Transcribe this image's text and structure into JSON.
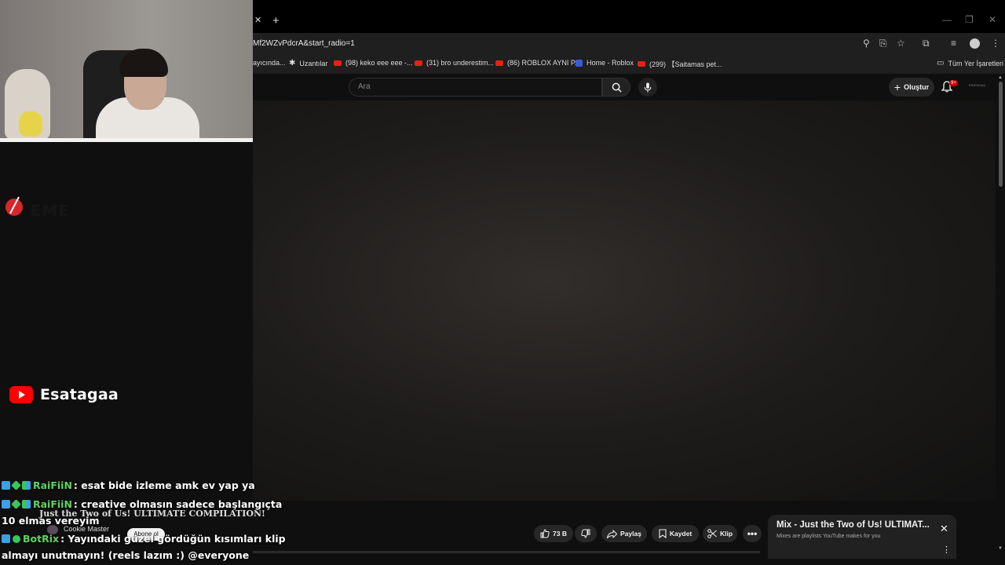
{
  "browser": {
    "url": "Mf2WZvPdcrA&start_radio=1",
    "bookmarks": [
      {
        "label": "ayıcında...",
        "icon": "none"
      },
      {
        "label": "Uzantılar",
        "icon": "puzzle"
      },
      {
        "label": "(98) keko eee eee -...",
        "icon": "youtube"
      },
      {
        "label": "(31) bro underestim...",
        "icon": "youtube"
      },
      {
        "label": "(86) ROBLOX AYNI P...",
        "icon": "youtube"
      },
      {
        "label": "Home - Roblox",
        "icon": "roblox"
      },
      {
        "label": "(299) 【Saitamas pet...",
        "icon": "youtube"
      }
    ],
    "all_bookmarks": "Tüm Yer İşaretleri"
  },
  "youtube": {
    "search_placeholder": "Ara",
    "create_label": "Oluştur",
    "notification_count": "9+",
    "avatar_text": "ESATAGAA"
  },
  "overlay": {
    "channel_name": "Esatagaa"
  },
  "chat": [
    {
      "user": "RaiFiiN",
      "message": " : esat bide izleme amk ev yap ya"
    },
    {
      "user": "RaiFiiN",
      "message": " : creative olmasın sadece başlangıçta"
    },
    {
      "continuation": "10 elmas vereyim"
    },
    {
      "user": "BotRix",
      "message": " : Yayındaki güzel gördüğün kısımları klip"
    },
    {
      "continuation": "almayı unutmayın! (reels lazım :) @everyone"
    }
  ],
  "video": {
    "title": "Just the Two of Us! ULTIMATE COMPILATION!",
    "channel": "Cookie Master",
    "subscribe_label": "Abone ol",
    "likes": "73 B",
    "share_label": "Paylaş",
    "save_label": "Kaydet",
    "clip_label": "Klip"
  },
  "mix": {
    "title": "Mix - Just the Two of Us! ULTIMAT...",
    "subtitle": "Mixes are playlists YouTube makes for you"
  },
  "colors": {
    "youtube_red": "#ff0000",
    "background": "#0f0f0f",
    "chat_username_green": "#5fd35f"
  }
}
